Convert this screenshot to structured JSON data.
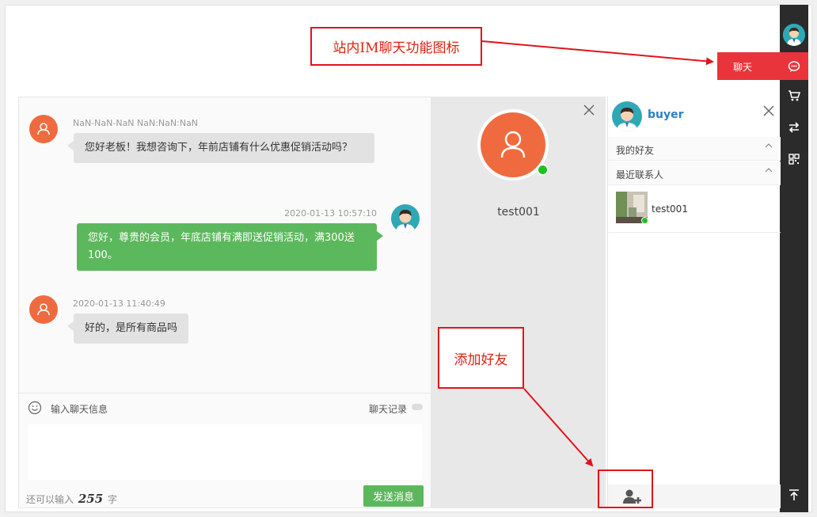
{
  "toolbar": {
    "chat_label": "聊天",
    "icons": [
      "user-avatar",
      "chat-bubble-icon",
      "cart-icon",
      "swap-icon",
      "qrcode-icon",
      "back-to-top-icon"
    ]
  },
  "chat": {
    "messages": [
      {
        "side": "left",
        "meta": "NaN-NaN-NaN NaN:NaN:NaN",
        "text": "您好老板！我想咨询下，年前店铺有什么优惠促销活动吗？"
      },
      {
        "side": "right",
        "meta": "2020-01-13 10:57:10",
        "text": "您好，尊贵的会员，年底店铺有满即送促销活动，满300送100。"
      },
      {
        "side": "left",
        "meta": "2020-01-13 11:40:49",
        "text": "好的，是所有商品吗"
      }
    ],
    "input_placeholder": "输入聊天信息",
    "history_label": "聊天记录",
    "counter_prefix": "还可以输入",
    "counter_value": "255",
    "counter_suffix": "字",
    "send_label": "发送消息"
  },
  "contact": {
    "name": "test001",
    "status_color": "#1ec31e"
  },
  "friends": {
    "user_name": "buyer",
    "sections": [
      "我的好友",
      "最近联系人"
    ],
    "recent": [
      {
        "name": "test001"
      }
    ]
  },
  "annotations": {
    "im_label": "站内IM聊天功能图标",
    "add_friend_label": "添加好友"
  },
  "colors": {
    "accent_red": "#e9343b",
    "green": "#5cb85c",
    "orange_avatar": "#ef6b3f",
    "toolbar": "#2b2b2b",
    "link_blue": "#2d7ec4"
  }
}
